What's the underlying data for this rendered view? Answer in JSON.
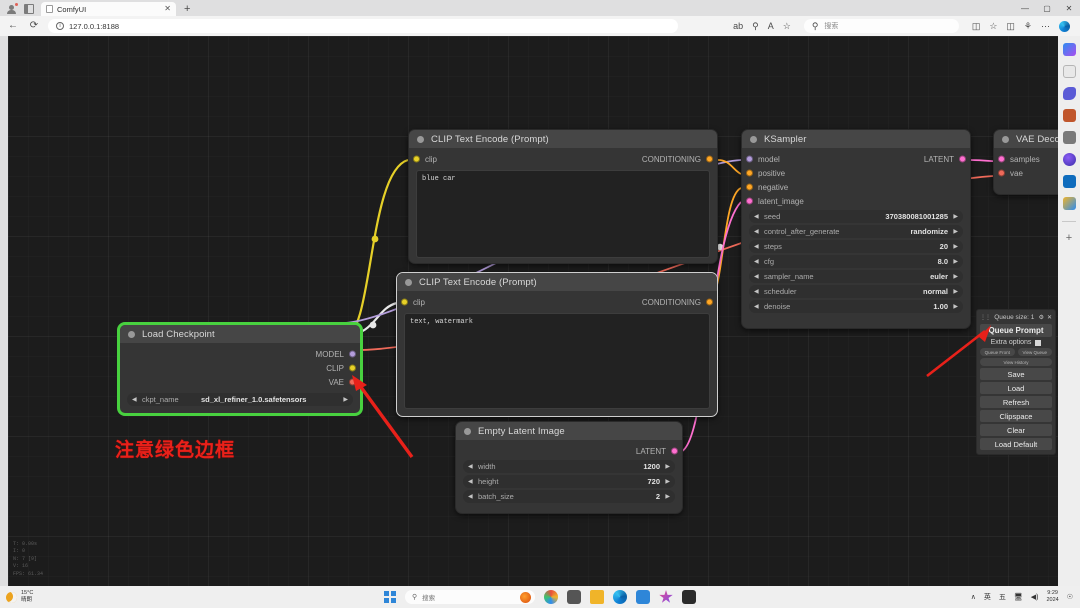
{
  "browser": {
    "tab_title": "ComfyUI",
    "tab_close": "✕",
    "new_tab": "+",
    "back_icon": "←",
    "reload_icon": "⟳",
    "info_icon": "ⓘ",
    "url": "127.0.0.1:8188",
    "read_aloud_icon": "ab",
    "find_icon": "🔍",
    "font_icon": "A",
    "favorite_icon": "☆",
    "search_placeholder": "搜索",
    "search_icon": "search-icon",
    "split_icon": "▯▯",
    "collections_icon": "⛉",
    "copilot_icon": "●",
    "more_icon": "⋯",
    "minimize": "—",
    "maximize": "▢",
    "close": "✕"
  },
  "canvas": {
    "stats": [
      "T: 0.00s",
      "I: 0",
      "N: 7 [9]",
      "V: 16",
      "FPS: 61.34"
    ],
    "annotation": "注意绿色边框"
  },
  "nodes": {
    "clip_positive": {
      "title": "CLIP Text Encode (Prompt)",
      "input_label": "clip",
      "output_label": "CONDITIONING",
      "text": "blue car"
    },
    "clip_negative": {
      "title": "CLIP Text Encode (Prompt)",
      "input_label": "clip",
      "output_label": "CONDITIONING",
      "text": "text, watermark"
    },
    "ksampler": {
      "title": "KSampler",
      "inputs": [
        "model",
        "positive",
        "negative",
        "latent_image"
      ],
      "output_label": "LATENT",
      "widgets": [
        {
          "name": "seed",
          "value": "370380081001285"
        },
        {
          "name": "control_after_generate",
          "value": "randomize"
        },
        {
          "name": "steps",
          "value": "20"
        },
        {
          "name": "cfg",
          "value": "8.0"
        },
        {
          "name": "sampler_name",
          "value": "euler"
        },
        {
          "name": "scheduler",
          "value": "normal"
        },
        {
          "name": "denoise",
          "value": "1.00"
        }
      ],
      "arrow_left": "◀",
      "arrow_right": "▶"
    },
    "load_checkpoint": {
      "title": "Load Checkpoint",
      "outputs": [
        "MODEL",
        "CLIP",
        "VAE"
      ],
      "widget": {
        "name": "ckpt_name",
        "value": "sd_xl_refiner_1.0.safetensors"
      }
    },
    "empty_latent": {
      "title": "Empty Latent Image",
      "output_label": "LATENT",
      "widgets": [
        {
          "name": "width",
          "value": "1200"
        },
        {
          "name": "height",
          "value": "720"
        },
        {
          "name": "batch_size",
          "value": "2"
        }
      ]
    },
    "vae_decode": {
      "title": "VAE Deco",
      "inputs": [
        "samples",
        "vae"
      ]
    }
  },
  "queue_panel": {
    "title": "Queue size: 1",
    "gear_icon": "⚙",
    "close_icon": "✕",
    "queue_prompt": "Queue Prompt",
    "extra_options": "Extra options",
    "queue_front": "Queue Front",
    "view_queue": "View Queue",
    "view_history": "View History",
    "buttons": [
      "Save",
      "Load",
      "Refresh",
      "Clipspace",
      "Clear",
      "Load Default"
    ]
  },
  "taskbar": {
    "weather_temp": "15°C",
    "weather_desc": "晴朗",
    "search_placeholder": "搜索",
    "chevron": "∧",
    "ime_lang": "英",
    "ime_mode": "五",
    "network_icon": "🖳",
    "volume_icon": "◁",
    "clock_time": "9:29",
    "clock_date": "2024",
    "bell_icon": "🔔"
  },
  "colors": {
    "accent_clip": "#e6d028",
    "accent_model": "#b39ddb",
    "accent_vae": "#ef6a5a",
    "accent_cond": "#ffa726",
    "accent_latent": "#ff70d0",
    "selection": "#48d13f",
    "annotation": "#e8211a"
  }
}
